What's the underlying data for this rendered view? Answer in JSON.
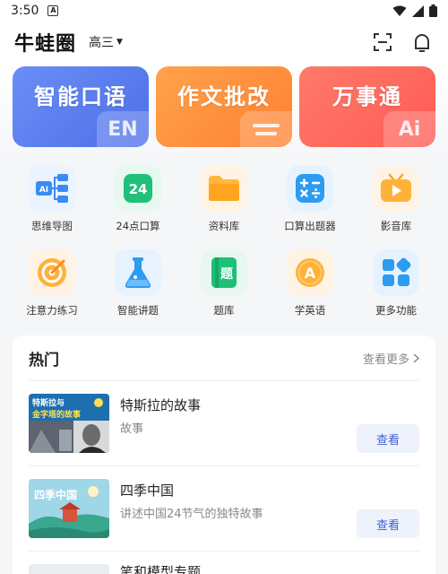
{
  "status_bar": {
    "time": "3:50",
    "notification_badge": "A",
    "icons": [
      "wifi-icon",
      "signal-icon",
      "battery-icon"
    ]
  },
  "header": {
    "app_title": "牛蛙圈",
    "grade": "高三",
    "icons": [
      "scan-icon",
      "message-icon"
    ]
  },
  "banners": [
    {
      "label": "智能口语",
      "badge": "EN",
      "color": "#5a7ff0"
    },
    {
      "label": "作文批改",
      "badge": "",
      "color": "#ff8f3a"
    },
    {
      "label": "万事通",
      "badge": "Ai",
      "color": "#ff6a5e"
    }
  ],
  "tools": [
    {
      "label": "思维导图",
      "icon": "mindmap-icon",
      "bg": "#eaf3ff"
    },
    {
      "label": "24点口算",
      "icon": "24-points-icon",
      "bg": "#e6f8ef"
    },
    {
      "label": "资料库",
      "icon": "folder-icon",
      "bg": "#fff3e4"
    },
    {
      "label": "口算出题器",
      "icon": "calculator-icon",
      "bg": "#e6f3ff"
    },
    {
      "label": "影音库",
      "icon": "tv-icon",
      "bg": "#fff3e4"
    },
    {
      "label": "注意力练习",
      "icon": "target-icon",
      "bg": "#fff3e4"
    },
    {
      "label": "智能讲题",
      "icon": "flask-icon",
      "bg": "#e6f3ff"
    },
    {
      "label": "题库",
      "icon": "question-bank-icon",
      "bg": "#e6f8ef"
    },
    {
      "label": "学英语",
      "icon": "english-icon",
      "bg": "#fff3e4"
    },
    {
      "label": "更多功能",
      "icon": "more-apps-icon",
      "bg": "#e6f3ff"
    }
  ],
  "hot": {
    "title": "热门",
    "more_label": "查看更多",
    "items": [
      {
        "title": "特斯拉的故事",
        "desc": "故事",
        "button": "查看",
        "thumb_text": "特斯拉与\n金字塔的故事"
      },
      {
        "title": "四季中国",
        "desc": "讲述中国24节气的独特故事",
        "button": "查看",
        "thumb_text": "四季中国"
      },
      {
        "title": "笔和模型专题"
      }
    ]
  }
}
